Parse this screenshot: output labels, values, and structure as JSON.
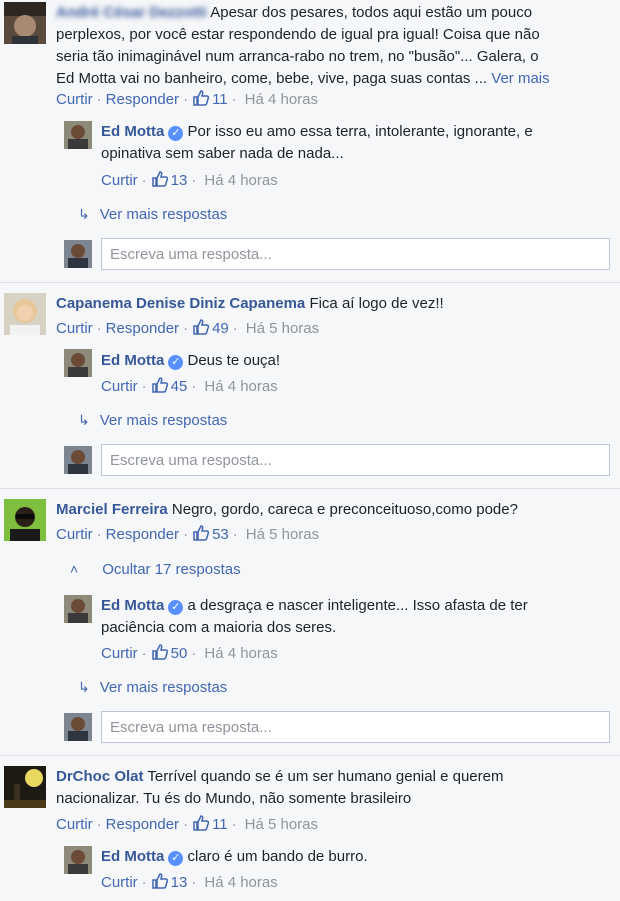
{
  "threads": [
    {
      "author": "André César Dezzotti",
      "text_lines": [
        "Apesar dos pesares, todos aqui estão um pouco",
        "perplexos, por você estar respondendo de igual pra igual! Coisa que não",
        "seria tão inimaginável num arranca-rabo no trem, no \"busão\"... Galera, o",
        "Ed Motta vai no banheiro, come, bebe, vive, paga suas contas ..."
      ],
      "see_more": "Ver mais",
      "like_label": "Curtir",
      "reply_label": "Responder",
      "likes": "11",
      "time": "Há 4 horas",
      "reply": {
        "author": "Ed Motta",
        "text_lines": [
          "Por isso eu amo essa terra, intolerante, ignorante, e",
          "opinativa sem saber nada de nada..."
        ],
        "like_label": "Curtir",
        "likes": "13",
        "time": "Há 4 horas"
      },
      "more_replies": "Ver mais respostas",
      "reply_placeholder": "Escreva uma resposta..."
    },
    {
      "author": "Capanema Denise Diniz Capanema",
      "text": "Fica aí logo de vez!!",
      "like_label": "Curtir",
      "reply_label": "Responder",
      "likes": "49",
      "time": "Há 5 horas",
      "reply": {
        "author": "Ed Motta",
        "text": "Deus te ouça!",
        "like_label": "Curtir",
        "likes": "45",
        "time": "Há 4 horas"
      },
      "more_replies": "Ver mais respostas",
      "reply_placeholder": "Escreva uma resposta..."
    },
    {
      "author": "Marciel Ferreira",
      "text": "Negro, gordo, careca e preconceituoso,como pode?",
      "like_label": "Curtir",
      "reply_label": "Responder",
      "likes": "53",
      "time": "Há 5 horas",
      "hide_replies": "Ocultar 17 respostas",
      "reply": {
        "author": "Ed Motta",
        "text_lines": [
          "a desgraça e nascer inteligente... Isso afasta de ter",
          "paciência com a maioria dos seres."
        ],
        "like_label": "Curtir",
        "likes": "50",
        "time": "Há 4 horas"
      },
      "more_replies": "Ver mais respostas",
      "reply_placeholder": "Escreva uma resposta..."
    },
    {
      "author": "DrChoc Olat",
      "text_lines": [
        "Terrível quando se é um ser humano genial e querem",
        "nacionalizar. Tu és do Mundo, não somente brasileiro"
      ],
      "like_label": "Curtir",
      "reply_label": "Responder",
      "likes": "11",
      "time": "Há 5 horas",
      "reply": {
        "author": "Ed Motta",
        "text": "claro é um bando de burro.",
        "like_label": "Curtir",
        "likes": "13",
        "time": "Há 4 horas"
      }
    }
  ],
  "colors": {
    "background": "#f6f7f9",
    "link": "#4267b2",
    "author": "#365899",
    "meta": "#90949c",
    "verified": "#5890ff"
  },
  "icons": {
    "like": "thumbs-up-icon",
    "verified": "verified-badge-icon",
    "reply_arrow": "reply-arrow-icon",
    "collapse": "chevron-up-icon"
  }
}
